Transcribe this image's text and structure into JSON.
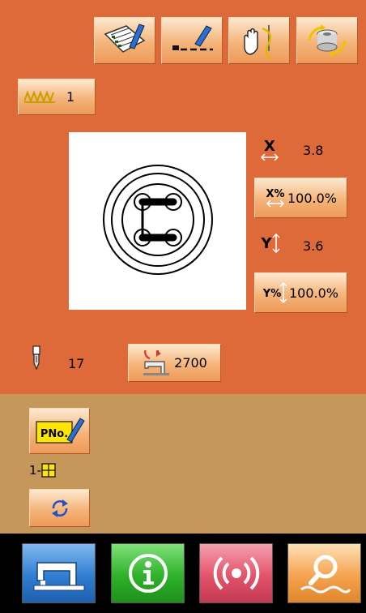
{
  "toolbar": {
    "icons": [
      "pattern-edit-icon",
      "stitch-edit-icon",
      "manual-needle-icon",
      "winder-icon"
    ]
  },
  "stitch_count": {
    "value": "1"
  },
  "pattern_scale": {
    "x_value": "3.8",
    "x_scale": "100.0%",
    "x_scale_icon_text": "X%",
    "x_icon_text": "X",
    "y_value": "3.6",
    "y_scale": "100.0%",
    "y_scale_icon_text": "Y%",
    "y_icon_text": "Y"
  },
  "needle": {
    "value": "17"
  },
  "speed": {
    "value": "2700"
  },
  "pattern_number": {
    "button_text": "PNo.",
    "item_label": "1-"
  },
  "bottom_nav": [
    "sewing-machine-icon",
    "info-icon",
    "communication-icon",
    "search-icon"
  ]
}
